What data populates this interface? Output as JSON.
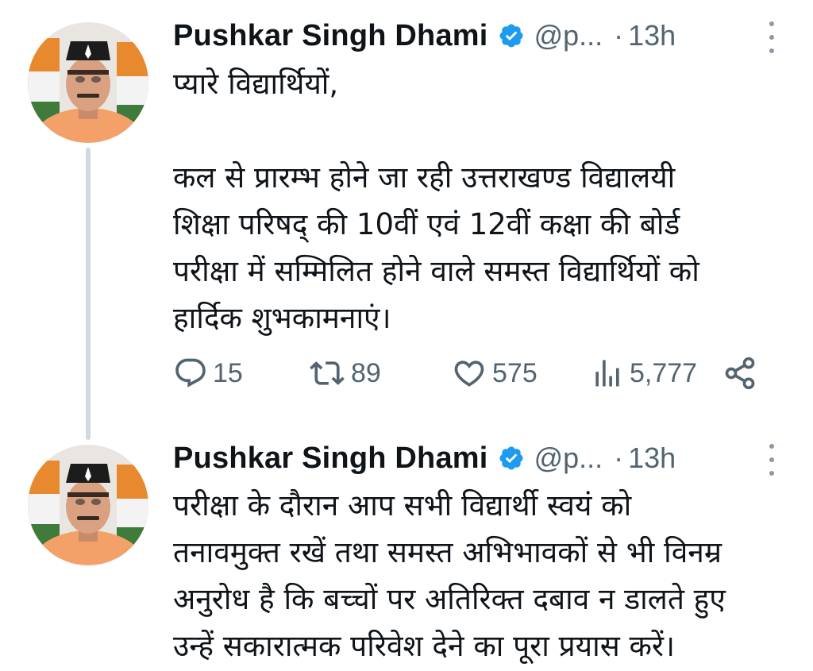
{
  "tweets": [
    {
      "author": {
        "name": "Pushkar Singh Dhami",
        "handle": "@p...",
        "separator": "·",
        "time": "13h"
      },
      "lines": [
        "प्यारे विद्यार्थियों,",
        "",
        "कल से प्रारम्भ होने जा रही उत्तराखण्ड विद्यालयी",
        "शिक्षा परिषद् की 10वीं एवं 12वीं कक्षा की बोर्ड",
        "परीक्षा में सम्मिलित होने वाले समस्त विद्यार्थियों को",
        "हार्दिक शुभकामनाएं।"
      ],
      "stats": {
        "replies": "15",
        "reposts": "89",
        "likes": "575",
        "views": "5,777"
      }
    },
    {
      "author": {
        "name": "Pushkar Singh Dhami",
        "handle": "@p...",
        "separator": "·",
        "time": "13h"
      },
      "lines": [
        "परीक्षा के दौरान आप सभी विद्यार्थी स्वयं को",
        "तनावमुक्त रखें तथा समस्त अभिभावकों से भी विनम्र",
        "अनुरोध है कि बच्चों पर अतिरिक्त दबाव न डालते हुए",
        "उन्हें सकारात्मक परिवेश देने का पूरा प्रयास करें।"
      ]
    }
  ],
  "icons": {
    "verified": "verified-badge-icon",
    "more": "more-vertical-icon",
    "reply": "reply-icon",
    "repost": "repost-icon",
    "like": "heart-icon",
    "views": "views-icon",
    "share": "share-icon"
  },
  "colors": {
    "text": "#0f1419",
    "secondary": "#536471",
    "verified": "#1d9bf0",
    "thread_line": "#cfd9de"
  }
}
